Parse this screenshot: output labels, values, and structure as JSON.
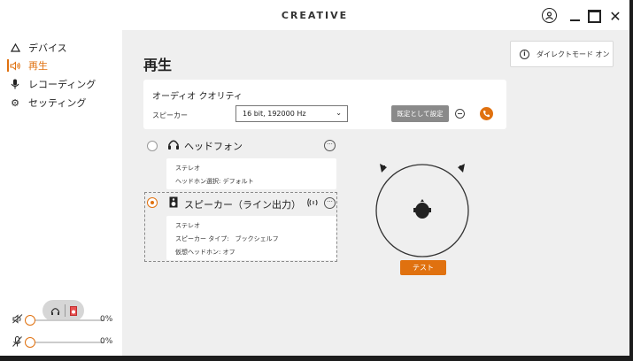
{
  "app": {
    "brand": "CREATIVE"
  },
  "sidebar": {
    "items": [
      {
        "label": "デバイス",
        "icon": "triangle-icon",
        "active": false
      },
      {
        "label": "再生",
        "icon": "speaker-wave-icon",
        "active": true
      },
      {
        "label": "レコーディング",
        "icon": "mic-icon",
        "active": false
      },
      {
        "label": "セッティング",
        "icon": "gear-icon",
        "active": false
      }
    ],
    "volumes": [
      {
        "icon": "speaker-mute-icon",
        "value": "0%",
        "level": 0
      },
      {
        "icon": "mic-mute-icon",
        "value": "0%",
        "level": 0
      }
    ]
  },
  "main": {
    "title": "再生",
    "direct_mode_label": "ダイレクトモード オン",
    "quality": {
      "title": "オーディオ クオリティ",
      "speaker_label": "スピーカー",
      "selected_format": "16 bit, 192000 Hz",
      "default_button": "既定として設定"
    },
    "devices": [
      {
        "name": "ヘッドフォン",
        "icon": "headphones-icon",
        "selected": false,
        "details": [
          "ステレオ",
          "ヘッドホン選択: デフォルト"
        ]
      },
      {
        "name": "スピーカー（ライン出力）",
        "icon": "speaker-icon",
        "selected": true,
        "details": [
          "ステレオ",
          "スピーカー タイプ:　ブックシェルフ",
          "仮想ヘッドホン: オフ"
        ]
      }
    ],
    "test_button": "テスト"
  },
  "colors": {
    "accent": "#e0710f",
    "background": "#efefef"
  }
}
